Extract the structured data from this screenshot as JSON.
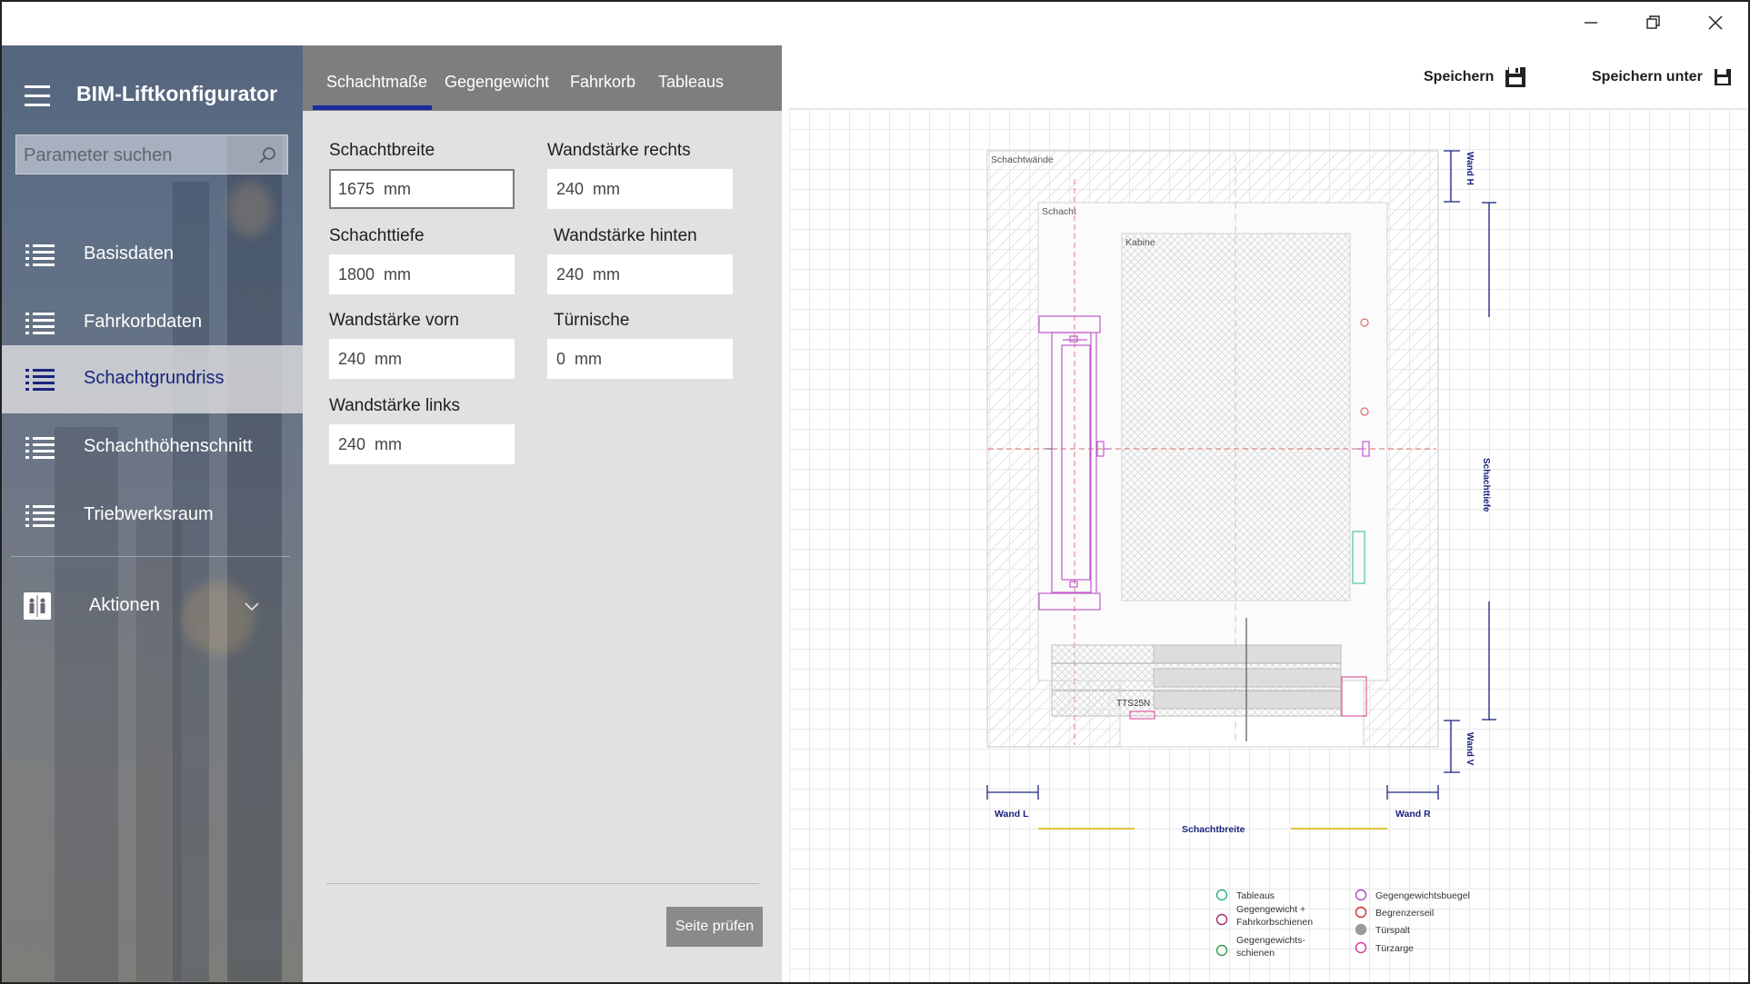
{
  "window": {
    "controls": [
      "minimize",
      "restore",
      "close"
    ]
  },
  "sidebar": {
    "title": "BIM-Liftkonfigurator",
    "search_placeholder": "Parameter suchen",
    "items": [
      {
        "label": "Basisdaten",
        "icon": "list-icon"
      },
      {
        "label": "Fahrkorbdaten",
        "icon": "list-icon"
      },
      {
        "label": "Schachtgrundriss",
        "icon": "list-icon",
        "active": true
      },
      {
        "label": "Schachthöhenschnitt",
        "icon": "list-icon"
      },
      {
        "label": "Triebwerksraum",
        "icon": "list-icon"
      }
    ],
    "actions_label": "Aktionen",
    "accent_color": "#1a237e"
  },
  "form": {
    "tabs": [
      "Schachtmaße",
      "Gegengewicht",
      "Fahrkorb",
      "Tableaus"
    ],
    "active_tab": "Schachtmaße",
    "fields": {
      "schachtbreite": {
        "label": "Schachtbreite",
        "value": "1675  mm"
      },
      "wand_rechts": {
        "label": "Wandstärke rechts",
        "value": "240  mm"
      },
      "schachttiefe": {
        "label": "Schachttiefe",
        "value": "1800  mm"
      },
      "wand_hinten": {
        "label": "Wandstärke hinten",
        "value": "240  mm"
      },
      "wand_vorn": {
        "label": "Wandstärke vorn",
        "value": "240  mm"
      },
      "tuernische": {
        "label": "Türnische",
        "value": "0  mm"
      },
      "wand_links": {
        "label": "Wandstärke links",
        "value": "240  mm"
      }
    },
    "check_button": "Seite prüfen"
  },
  "toolbar": {
    "save_label": "Speichern",
    "save_as_label": "Speichern unter"
  },
  "plan": {
    "labels": {
      "schachtwaende": "Schachtwände",
      "schacht": "Schacht",
      "kabine": "Kabine",
      "door": "TTS25N",
      "wand_h": "Wand H",
      "wand_v": "Wand V",
      "wand_l": "Wand L",
      "wand_r": "Wand R",
      "schachttiefe": "Schachttiefe",
      "schachtbreite": "Schachtbreite"
    },
    "legend": [
      {
        "label": "Tableaus",
        "color": "#2db37a"
      },
      {
        "label": "Gegengewicht +",
        "label2": "Fahrkorbschienen",
        "color": "#a0306a"
      },
      {
        "label": "Gegengewichts-",
        "label2": "schienen",
        "color": "#2e9c4f"
      },
      {
        "label": "Gegengewichtsbuegel",
        "color": "#b04ac0"
      },
      {
        "label": "Begrenzerseil",
        "color": "#d42c2c"
      },
      {
        "label": "Türspalt",
        "color": "#9a9a9a"
      },
      {
        "label": "Türzarge",
        "color": "#d2389a"
      }
    ]
  }
}
